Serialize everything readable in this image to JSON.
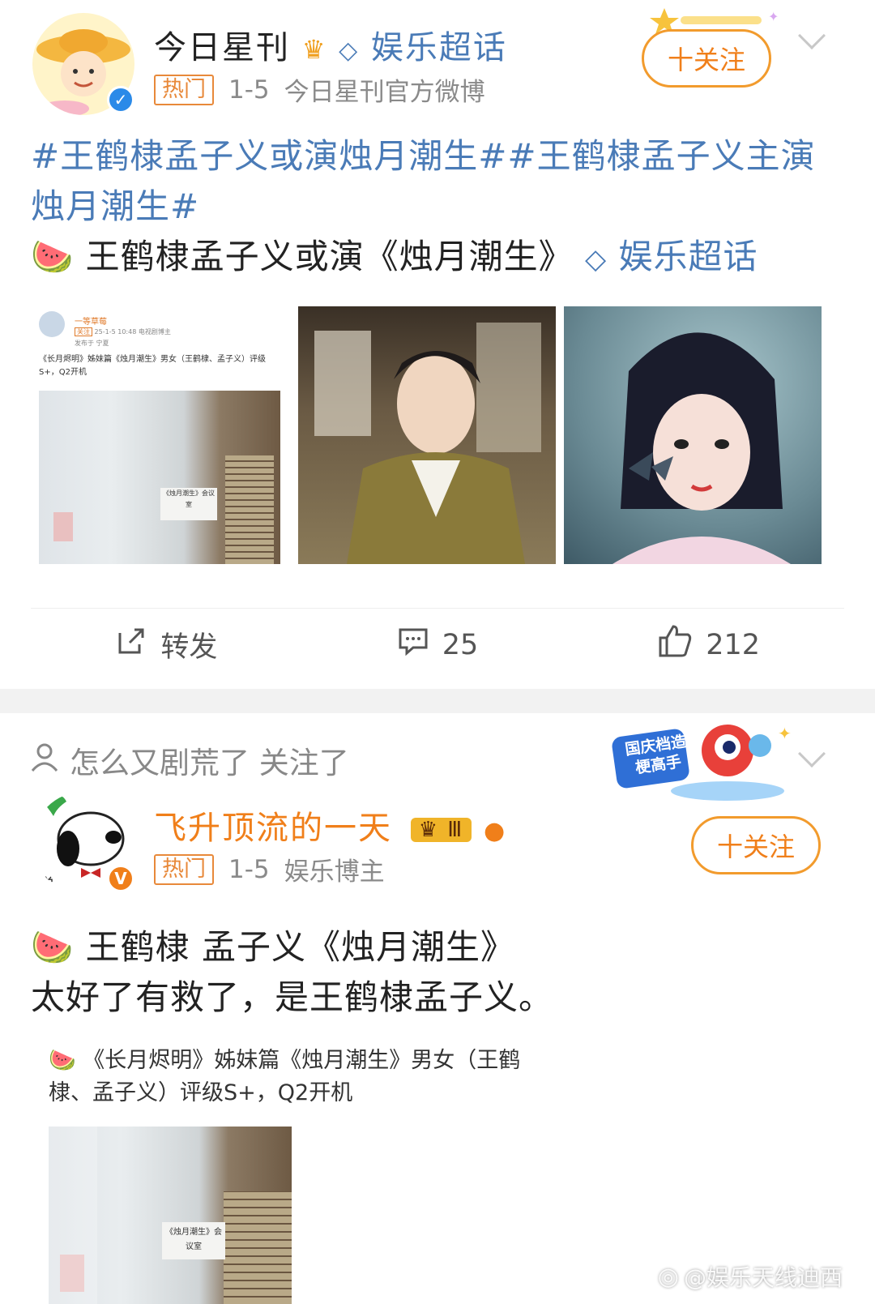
{
  "posts": [
    {
      "username": "今日星刊",
      "supertopic_badge": "娱乐超话",
      "hot_tag": "热门",
      "date": "1-5",
      "source": "今日星刊官方微博",
      "follow_label": "十关注",
      "hashtags_line": "#王鹤棣孟子义或演烛月潮生##王鹤棣孟子义主演烛月潮生#",
      "body_line": "王鹤棣孟子义或演《烛月潮生》",
      "supertopic_link": "娱乐超话",
      "thumb1": {
        "name": "一等草莓",
        "tag": "关注",
        "timestamp": "25-1-5 10:48",
        "role": "电视剧博主",
        "location": "发布于 宁夏",
        "text": "《长月烬明》姊妹篇《烛月潮生》男女（王鹤棣、孟子义）评级S+，Q2开机",
        "sign": "《烛月潮生》会议室"
      },
      "actions": {
        "repost": "转发",
        "comments": "25",
        "likes": "212"
      }
    },
    {
      "recommend": "怎么又剧荒了 关注了",
      "sticker_text": "国庆档造梗高手",
      "username": "飞升顶流的一天",
      "level_badge": "Ⅲ",
      "hot_tag": "热门",
      "date": "1-5",
      "source": "娱乐博主",
      "follow_label": "十关注",
      "body_line1": "王鹤棣 孟子义《烛月潮生》",
      "body_line2": "太好了有救了，是王鹤棣孟子义。",
      "quote_text": "《长月烬明》姊妹篇《烛月潮生》男女（王鹤棣、孟子义）评级S+，Q2开机",
      "quote_sign": "《烛月潮生》会议室"
    }
  ],
  "watermark": "@娱乐天线迪西",
  "colors": {
    "topic": "#4a7bb7",
    "follow": "#f07f1a",
    "vip_blue": "#2b8ae8",
    "vip_orange": "#f07f1a"
  }
}
